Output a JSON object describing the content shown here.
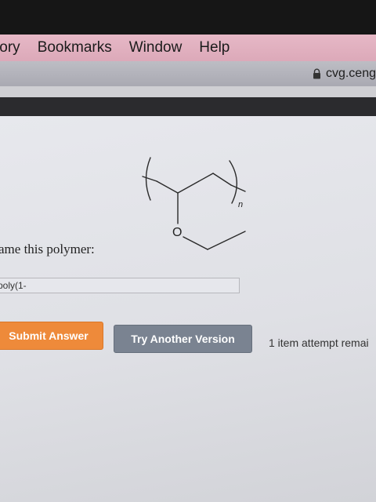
{
  "menubar": {
    "items": [
      "tory",
      "Bookmarks",
      "Window",
      "Help"
    ]
  },
  "urlbar": {
    "url": "cvg.ceng",
    "lock_icon": "lock-icon"
  },
  "question": {
    "structure_labels": {
      "oxygen": "O",
      "subscript": "n"
    },
    "prompt": "ame this polymer:",
    "answer_value": "poly(1-"
  },
  "actions": {
    "submit_label": "Submit Answer",
    "another_label": "Try Another Version",
    "attempts_text": "1 item attempt remai"
  },
  "colors": {
    "menubar": "#dca9b9",
    "submit_button": "#ee8a3a",
    "another_button": "#7a8391"
  }
}
